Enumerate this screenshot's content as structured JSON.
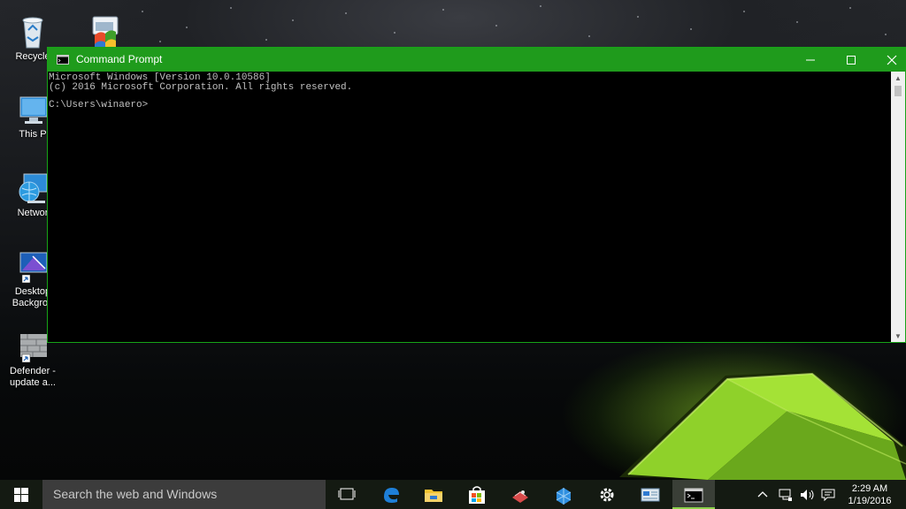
{
  "desktop": {
    "icons": [
      {
        "label": "Recycle",
        "icon": "recycle-bin-icon"
      },
      {
        "label": "This P",
        "icon": "this-pc-icon"
      },
      {
        "label": "Networ",
        "icon": "network-icon"
      },
      {
        "label": "Desktop",
        "label2": "Backgrou",
        "icon": "desktop-background-icon"
      },
      {
        "label": "Defender -",
        "label2": "update a...",
        "icon": "defender-update-icon"
      }
    ]
  },
  "window": {
    "title": "Command Prompt",
    "accent": "#1f9b1c",
    "console_lines": [
      "Microsoft Windows [Version 10.0.10586]",
      "(c) 2016 Microsoft Corporation. All rights reserved.",
      "",
      "C:\\Users\\winaero>"
    ]
  },
  "taskbar": {
    "search_placeholder": "Search the web and Windows",
    "apps": [
      "task-view-icon",
      "edge-icon",
      "file-explorer-icon",
      "store-icon",
      "game-icon",
      "dev-tool-icon",
      "settings-icon",
      "control-panel-icon",
      "command-prompt-icon"
    ],
    "clock": {
      "time": "2:29 AM",
      "date": "1/19/2016"
    }
  }
}
